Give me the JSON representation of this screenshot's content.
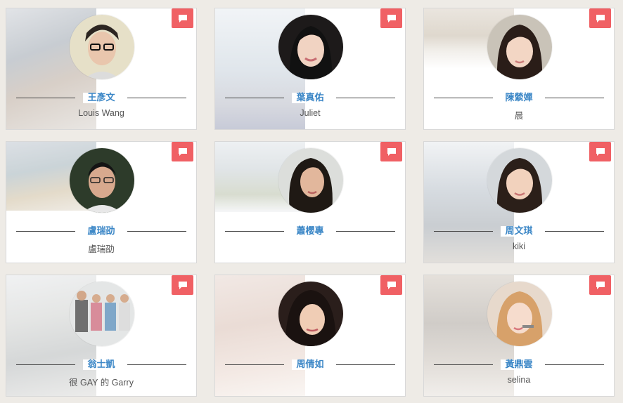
{
  "chat_icon": "speech-bubble-icon",
  "accent_color": "#f06064",
  "name_color": "#3a86c6",
  "profiles": [
    {
      "name": "王彥文",
      "subtitle": "Louis Wang"
    },
    {
      "name": "葉真佑",
      "subtitle": "Juliet"
    },
    {
      "name": "陳縈嬋",
      "subtitle": "晨"
    },
    {
      "name": "盧瑞劭",
      "subtitle": "盧瑞劭"
    },
    {
      "name": "蕭櫻專",
      "subtitle": ""
    },
    {
      "name": "周文琪",
      "subtitle": "kiki"
    },
    {
      "name": "翁士凱",
      "subtitle": "很 GAY 的 Garry"
    },
    {
      "name": "周倩如",
      "subtitle": ""
    },
    {
      "name": "黃鼎雲",
      "subtitle": "selina"
    }
  ]
}
